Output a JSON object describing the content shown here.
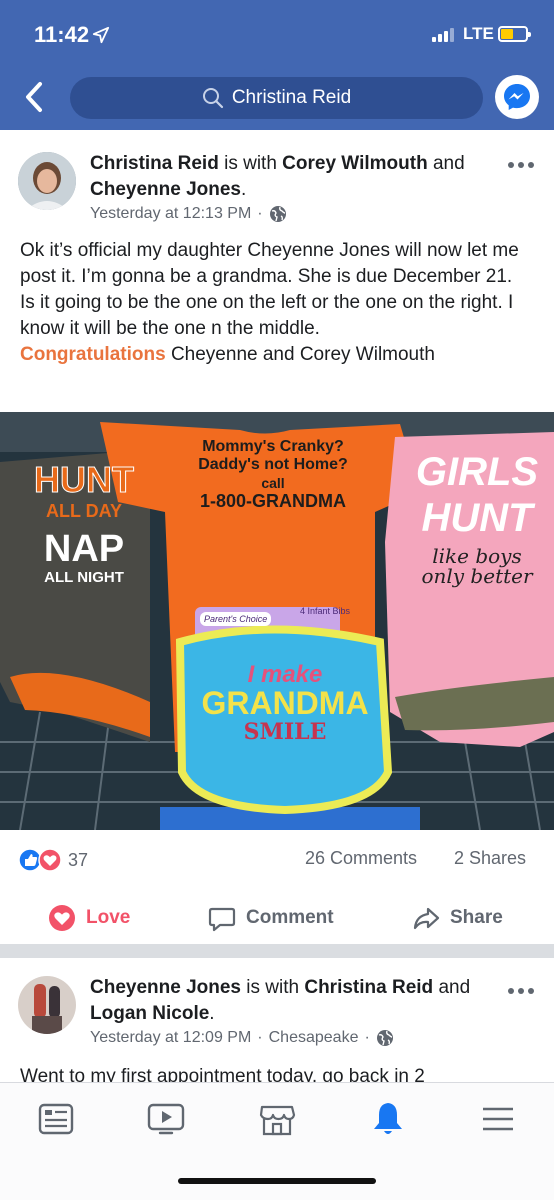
{
  "status": {
    "time": "11:42",
    "network": "LTE"
  },
  "search": {
    "query": "Christina Reid"
  },
  "post1": {
    "author": "Christina Reid",
    "with_text": "is with",
    "tag1": "Corey Wilmouth",
    "and_text": "and",
    "tag2": "Cheyenne Jones",
    "period": ".",
    "timestamp": "Yesterday at 12:13 PM",
    "body": "Ok it’s official my daughter Cheyenne Jones will now let me post it. I’m gonna be a grandma. She is due December 21.",
    "body2": "Is it going to be the one on the left or the one on the right. I know it will be the one n the middle.",
    "highlight": "Congratulations",
    "body3": " Cheyenne and Corey Wilmouth",
    "photo": {
      "left_shirt": {
        "line1": "HUNT",
        "line2": "ALL DAY",
        "line3": "NAP",
        "line4": "ALL NIGHT"
      },
      "center_shirt": {
        "line1": "Mommy's Cranky?",
        "line2": "Daddy's not Home?",
        "line3": "call",
        "line4": "1-800-GRANDMA"
      },
      "right_shirt": {
        "line1": "GIRLS",
        "line2": "HUNT",
        "line3": "like boys",
        "line4": "only better"
      },
      "bib": {
        "line1": "I make",
        "line2": "GRANDMA",
        "line3": "SMILE"
      },
      "tag": {
        "brand": "Parent's Choice",
        "label": "4 Infant Bibs"
      }
    },
    "reactions_count": "37",
    "comments": "26 Comments",
    "shares": "2 Shares",
    "actions": {
      "love": "Love",
      "comment": "Comment",
      "share": "Share"
    },
    "colors": {
      "love": "#f25268",
      "like": "#1877f2",
      "highlight": "#e9743e"
    }
  },
  "post2": {
    "author": "Cheyenne Jones",
    "with_text": "is with",
    "tag1": "Christina Reid",
    "and_text": "and",
    "tag2": "Logan Nicole",
    "period": ".",
    "timestamp": "Yesterday at 12:09 PM",
    "location": "Chesapeake",
    "body": "Went to my first appointment today, go back in 2"
  },
  "tabbar": {
    "icons": [
      "news-feed-icon",
      "watch-icon",
      "marketplace-icon",
      "notifications-icon",
      "menu-icon"
    ]
  }
}
